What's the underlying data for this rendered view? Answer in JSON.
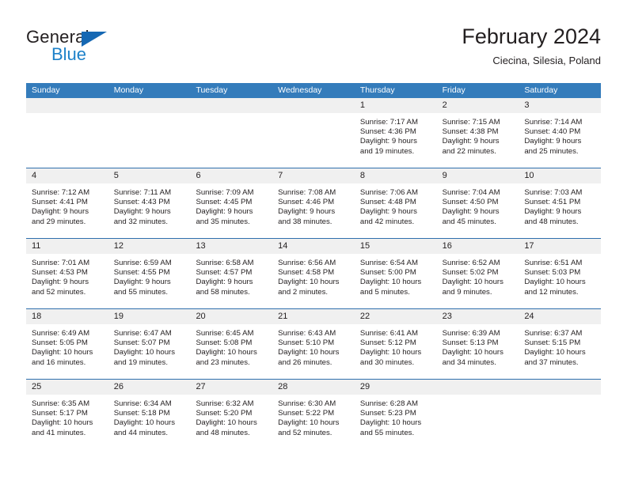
{
  "brand": {
    "name_part1": "General",
    "name_part2": "Blue",
    "triangle_color": "#1668b3",
    "blue_color": "#1d81c9"
  },
  "header": {
    "title": "February 2024",
    "subtitle": "Ciecina, Silesia, Poland"
  },
  "theme": {
    "header_row_bg": "#347cbb",
    "row_divider": "#2f6fad",
    "day_band_bg": "#f0f0f0"
  },
  "weekdays": [
    "Sunday",
    "Monday",
    "Tuesday",
    "Wednesday",
    "Thursday",
    "Friday",
    "Saturday"
  ],
  "weeks": [
    [
      {
        "day": "",
        "empty": true,
        "lines": []
      },
      {
        "day": "",
        "empty": true,
        "lines": []
      },
      {
        "day": "",
        "empty": true,
        "lines": []
      },
      {
        "day": "",
        "empty": true,
        "lines": []
      },
      {
        "day": "1",
        "empty": false,
        "lines": [
          "Sunrise: 7:17 AM",
          "Sunset: 4:36 PM",
          "Daylight: 9 hours",
          "and 19 minutes."
        ]
      },
      {
        "day": "2",
        "empty": false,
        "lines": [
          "Sunrise: 7:15 AM",
          "Sunset: 4:38 PM",
          "Daylight: 9 hours",
          "and 22 minutes."
        ]
      },
      {
        "day": "3",
        "empty": false,
        "lines": [
          "Sunrise: 7:14 AM",
          "Sunset: 4:40 PM",
          "Daylight: 9 hours",
          "and 25 minutes."
        ]
      }
    ],
    [
      {
        "day": "4",
        "empty": false,
        "lines": [
          "Sunrise: 7:12 AM",
          "Sunset: 4:41 PM",
          "Daylight: 9 hours",
          "and 29 minutes."
        ]
      },
      {
        "day": "5",
        "empty": false,
        "lines": [
          "Sunrise: 7:11 AM",
          "Sunset: 4:43 PM",
          "Daylight: 9 hours",
          "and 32 minutes."
        ]
      },
      {
        "day": "6",
        "empty": false,
        "lines": [
          "Sunrise: 7:09 AM",
          "Sunset: 4:45 PM",
          "Daylight: 9 hours",
          "and 35 minutes."
        ]
      },
      {
        "day": "7",
        "empty": false,
        "lines": [
          "Sunrise: 7:08 AM",
          "Sunset: 4:46 PM",
          "Daylight: 9 hours",
          "and 38 minutes."
        ]
      },
      {
        "day": "8",
        "empty": false,
        "lines": [
          "Sunrise: 7:06 AM",
          "Sunset: 4:48 PM",
          "Daylight: 9 hours",
          "and 42 minutes."
        ]
      },
      {
        "day": "9",
        "empty": false,
        "lines": [
          "Sunrise: 7:04 AM",
          "Sunset: 4:50 PM",
          "Daylight: 9 hours",
          "and 45 minutes."
        ]
      },
      {
        "day": "10",
        "empty": false,
        "lines": [
          "Sunrise: 7:03 AM",
          "Sunset: 4:51 PM",
          "Daylight: 9 hours",
          "and 48 minutes."
        ]
      }
    ],
    [
      {
        "day": "11",
        "empty": false,
        "lines": [
          "Sunrise: 7:01 AM",
          "Sunset: 4:53 PM",
          "Daylight: 9 hours",
          "and 52 minutes."
        ]
      },
      {
        "day": "12",
        "empty": false,
        "lines": [
          "Sunrise: 6:59 AM",
          "Sunset: 4:55 PM",
          "Daylight: 9 hours",
          "and 55 minutes."
        ]
      },
      {
        "day": "13",
        "empty": false,
        "lines": [
          "Sunrise: 6:58 AM",
          "Sunset: 4:57 PM",
          "Daylight: 9 hours",
          "and 58 minutes."
        ]
      },
      {
        "day": "14",
        "empty": false,
        "lines": [
          "Sunrise: 6:56 AM",
          "Sunset: 4:58 PM",
          "Daylight: 10 hours",
          "and 2 minutes."
        ]
      },
      {
        "day": "15",
        "empty": false,
        "lines": [
          "Sunrise: 6:54 AM",
          "Sunset: 5:00 PM",
          "Daylight: 10 hours",
          "and 5 minutes."
        ]
      },
      {
        "day": "16",
        "empty": false,
        "lines": [
          "Sunrise: 6:52 AM",
          "Sunset: 5:02 PM",
          "Daylight: 10 hours",
          "and 9 minutes."
        ]
      },
      {
        "day": "17",
        "empty": false,
        "lines": [
          "Sunrise: 6:51 AM",
          "Sunset: 5:03 PM",
          "Daylight: 10 hours",
          "and 12 minutes."
        ]
      }
    ],
    [
      {
        "day": "18",
        "empty": false,
        "lines": [
          "Sunrise: 6:49 AM",
          "Sunset: 5:05 PM",
          "Daylight: 10 hours",
          "and 16 minutes."
        ]
      },
      {
        "day": "19",
        "empty": false,
        "lines": [
          "Sunrise: 6:47 AM",
          "Sunset: 5:07 PM",
          "Daylight: 10 hours",
          "and 19 minutes."
        ]
      },
      {
        "day": "20",
        "empty": false,
        "lines": [
          "Sunrise: 6:45 AM",
          "Sunset: 5:08 PM",
          "Daylight: 10 hours",
          "and 23 minutes."
        ]
      },
      {
        "day": "21",
        "empty": false,
        "lines": [
          "Sunrise: 6:43 AM",
          "Sunset: 5:10 PM",
          "Daylight: 10 hours",
          "and 26 minutes."
        ]
      },
      {
        "day": "22",
        "empty": false,
        "lines": [
          "Sunrise: 6:41 AM",
          "Sunset: 5:12 PM",
          "Daylight: 10 hours",
          "and 30 minutes."
        ]
      },
      {
        "day": "23",
        "empty": false,
        "lines": [
          "Sunrise: 6:39 AM",
          "Sunset: 5:13 PM",
          "Daylight: 10 hours",
          "and 34 minutes."
        ]
      },
      {
        "day": "24",
        "empty": false,
        "lines": [
          "Sunrise: 6:37 AM",
          "Sunset: 5:15 PM",
          "Daylight: 10 hours",
          "and 37 minutes."
        ]
      }
    ],
    [
      {
        "day": "25",
        "empty": false,
        "lines": [
          "Sunrise: 6:35 AM",
          "Sunset: 5:17 PM",
          "Daylight: 10 hours",
          "and 41 minutes."
        ]
      },
      {
        "day": "26",
        "empty": false,
        "lines": [
          "Sunrise: 6:34 AM",
          "Sunset: 5:18 PM",
          "Daylight: 10 hours",
          "and 44 minutes."
        ]
      },
      {
        "day": "27",
        "empty": false,
        "lines": [
          "Sunrise: 6:32 AM",
          "Sunset: 5:20 PM",
          "Daylight: 10 hours",
          "and 48 minutes."
        ]
      },
      {
        "day": "28",
        "empty": false,
        "lines": [
          "Sunrise: 6:30 AM",
          "Sunset: 5:22 PM",
          "Daylight: 10 hours",
          "and 52 minutes."
        ]
      },
      {
        "day": "29",
        "empty": false,
        "lines": [
          "Sunrise: 6:28 AM",
          "Sunset: 5:23 PM",
          "Daylight: 10 hours",
          "and 55 minutes."
        ]
      },
      {
        "day": "",
        "empty": true,
        "lines": []
      },
      {
        "day": "",
        "empty": true,
        "lines": []
      }
    ]
  ]
}
